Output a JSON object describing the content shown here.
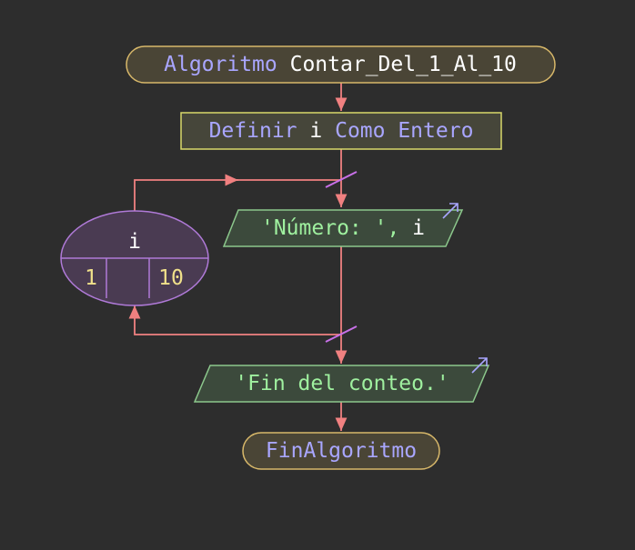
{
  "colors": {
    "background": "#2d2d2d",
    "keyword": "#a9a6ff",
    "identifier": "#ffffff",
    "string": "#9ff09f",
    "number": "#f0e08a",
    "terminator_border": "#d8b86a",
    "terminator_fill": "#4a4536",
    "define_border": "#d8d86a",
    "define_fill": "#46463a",
    "io_border": "#8cc88c",
    "io_fill": "#3c4a3c",
    "loop_border": "#b07ad8",
    "loop_fill": "#4a3b52",
    "arrow": "#f08080",
    "marker": "#c870e8"
  },
  "flowchart": {
    "start": {
      "keyword": "Algoritmo",
      "name": "Contar_Del_1_Al_10"
    },
    "define": {
      "kw1": "Definir",
      "var": "i",
      "kw2": "Como Entero"
    },
    "output1": {
      "text": "'Número: ', ",
      "var": "i"
    },
    "loop": {
      "variable": "i",
      "start": "1",
      "step": "",
      "end": "10"
    },
    "output2": {
      "text": "'Fin del conteo.'"
    },
    "end": {
      "keyword": "FinAlgoritmo"
    }
  }
}
